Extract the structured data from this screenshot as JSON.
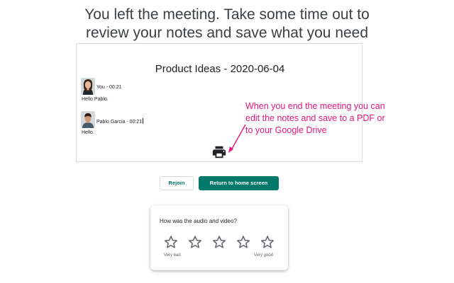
{
  "headline": {
    "line1": "You left the meeting. Take some time out to",
    "line2": "review your notes and save what you need"
  },
  "notes": {
    "title": "Product Ideas - 2020-06-04",
    "entries": [
      {
        "speaker_time": "You - 00:21",
        "message": "Hello Pablo.",
        "avatar": "woman-avatar"
      },
      {
        "speaker_time": "Pablo Garcia - 00:21",
        "message": "Hello.",
        "avatar": "man-avatar"
      }
    ],
    "print_icon": "printer-icon"
  },
  "annotation": {
    "line1": "When you end the meeting you can",
    "line2": "edit the notes and save to a PDF or",
    "line3": "to your Google Drive",
    "color": "#e0187a"
  },
  "buttons": {
    "rejoin": "Rejoin",
    "home": "Return to home screen",
    "accent": "#00796b"
  },
  "rating": {
    "question": "How was the audio and video?",
    "stars": 5,
    "selected": 0,
    "low_label": "Very bad",
    "high_label": "Very good"
  }
}
